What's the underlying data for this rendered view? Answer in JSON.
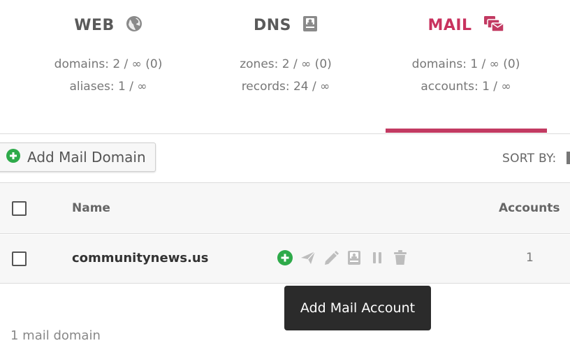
{
  "stats": {
    "web": {
      "title": "WEB",
      "icon": "globe-icon",
      "line1": "domains: 2 / ∞ (0)",
      "line2": "aliases: 1 / ∞"
    },
    "dns": {
      "title": "DNS",
      "icon": "address-book-icon",
      "line1": "zones: 2 / ∞ (0)",
      "line2": "records: 24 / ∞"
    },
    "mail": {
      "title": "MAIL",
      "icon": "mail-bulk-icon",
      "line1": "domains: 1 / ∞ (0)",
      "line2": "accounts: 1 / ∞",
      "active": true
    }
  },
  "toolbar": {
    "add_label": "Add Mail Domain",
    "add_icon": "plus-circle-icon",
    "sort_label": "SORT BY:"
  },
  "table": {
    "headers": {
      "name": "Name",
      "accounts": "Accounts"
    },
    "rows": [
      {
        "domain": "communitynews.us",
        "accounts": "1",
        "actions": [
          "add-account-icon",
          "send-icon",
          "edit-icon",
          "dns-records-icon",
          "suspend-icon",
          "delete-icon"
        ]
      }
    ]
  },
  "tooltip": {
    "text": "Add Mail Account"
  },
  "footer": {
    "count_text": "1 mail domain"
  },
  "colors": {
    "accent": "#c23a62",
    "add_green": "#2eaa4a",
    "icon_grey": "#bdbdbd",
    "tooltip_bg": "#2b2b2b"
  }
}
